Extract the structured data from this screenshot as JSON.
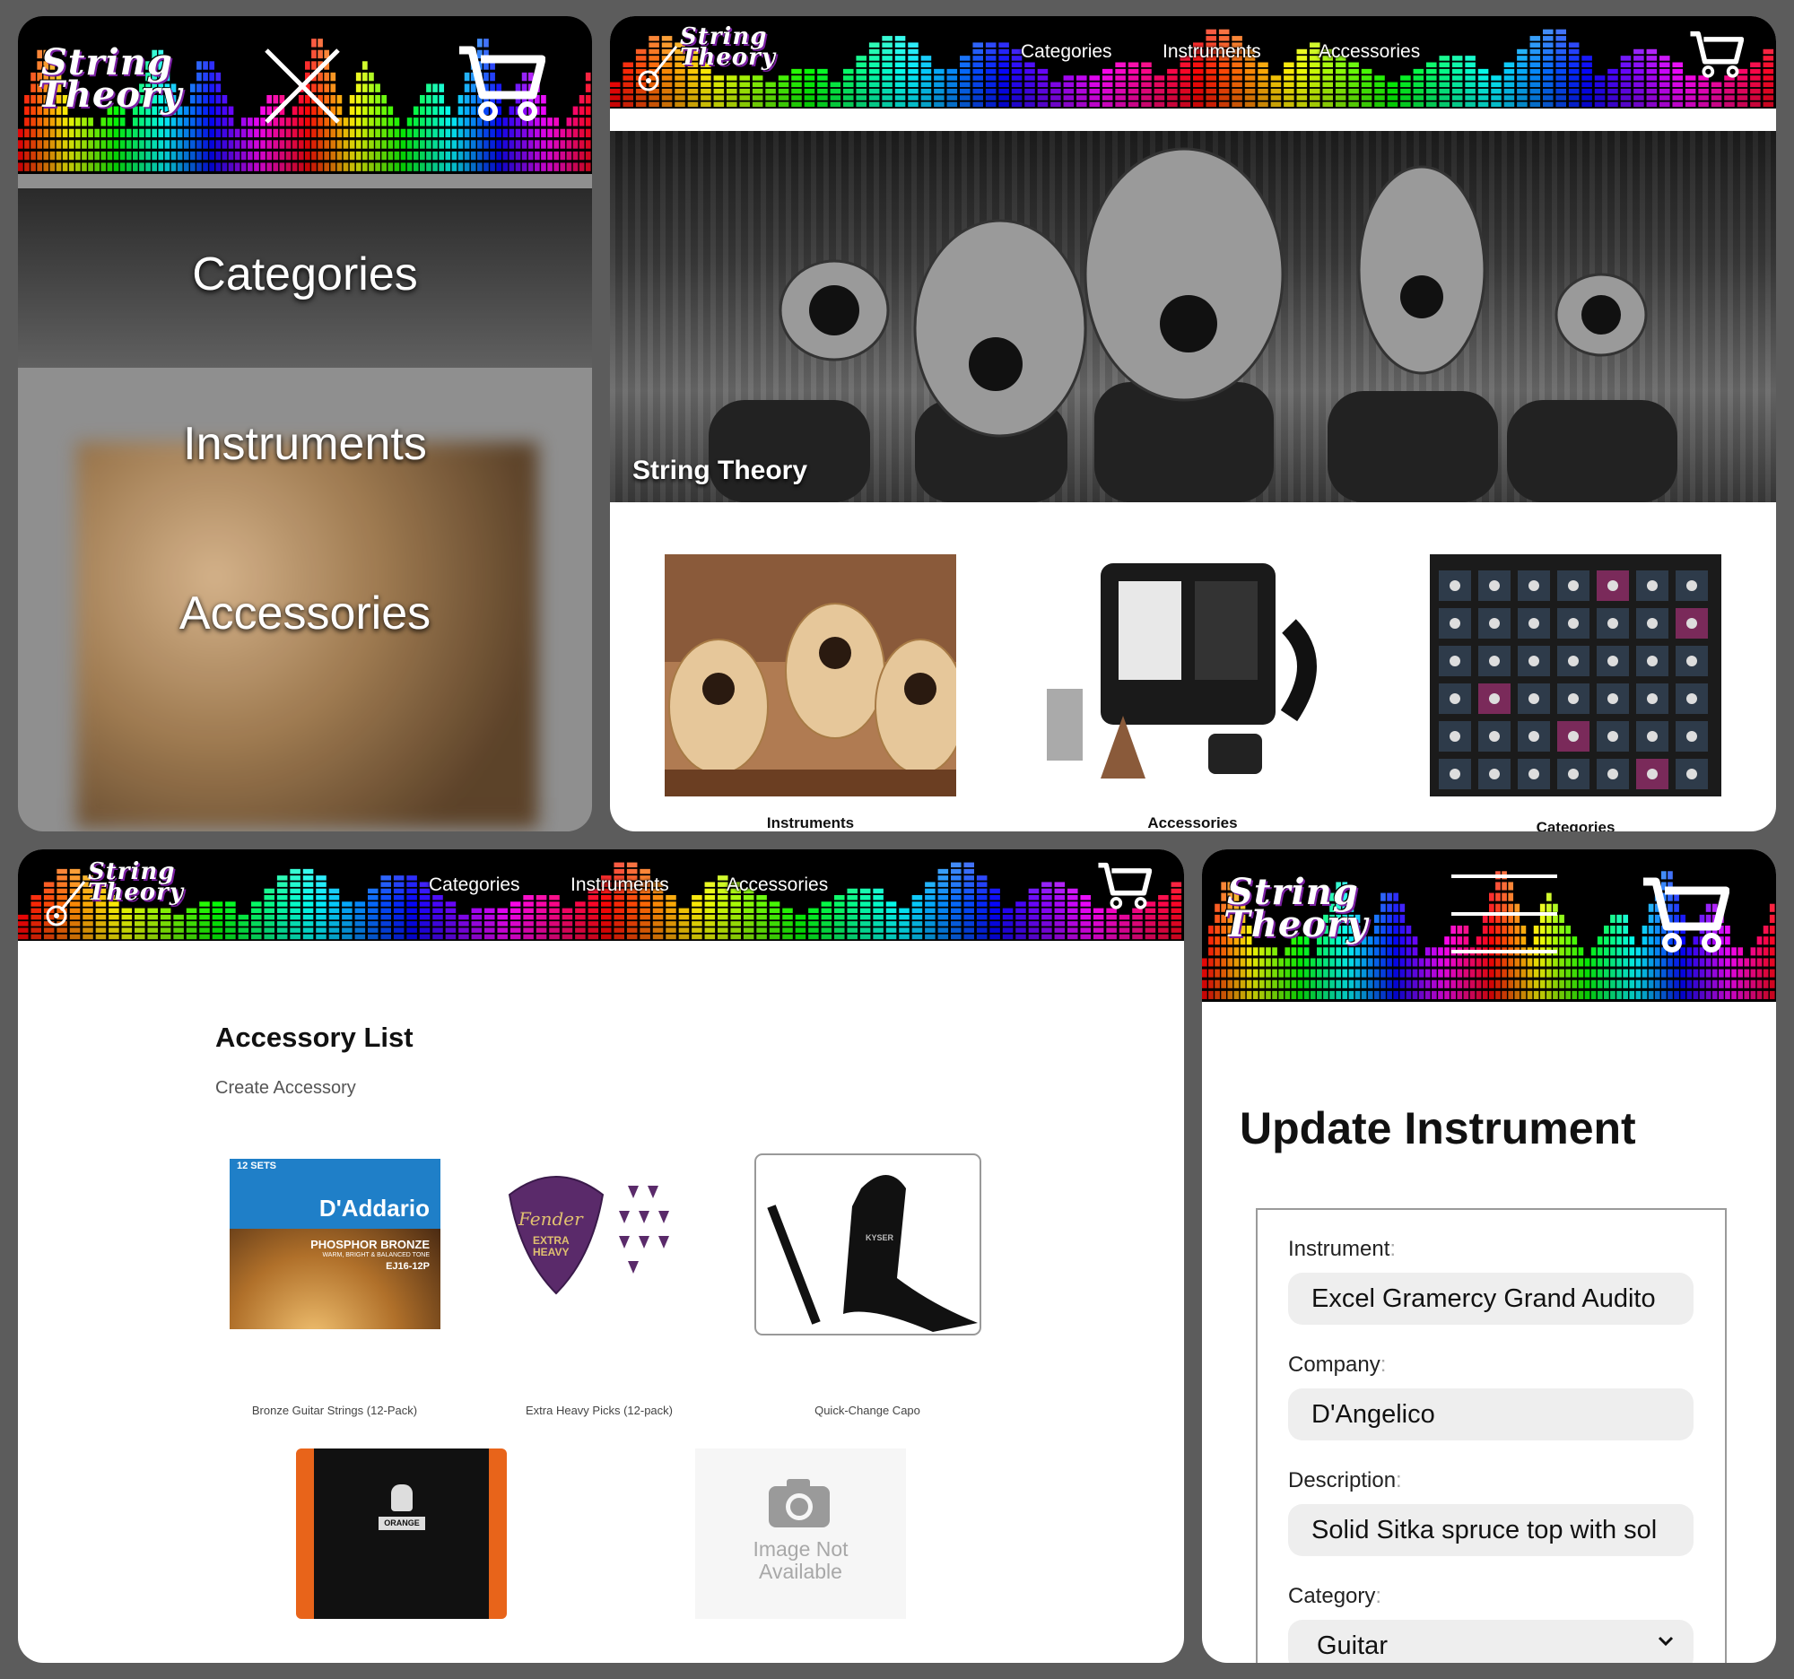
{
  "brand": {
    "line1": "String",
    "line2": "Theory"
  },
  "colors": {
    "page_bg": "#5c5c5c",
    "header_bg": "#000000",
    "accent_shadow": "#7a1fa2"
  },
  "mobile_menu": {
    "close_icon": "close-x-icon",
    "cart_icon": "shopping-cart-icon",
    "items": [
      "Categories",
      "Instruments",
      "Accessories"
    ]
  },
  "home": {
    "nav": [
      "Categories",
      "Instruments",
      "Accessories"
    ],
    "hero_title": "String Theory",
    "tiles": [
      {
        "caption": "Instruments"
      },
      {
        "caption": "Accessories"
      },
      {
        "caption": "Categories"
      }
    ]
  },
  "accessories": {
    "nav": [
      "Categories",
      "Instruments",
      "Accessories"
    ],
    "title": "Accessory List",
    "create_link": "Create Accessory",
    "items": [
      {
        "caption": "Bronze Guitar Strings (12-Pack)",
        "pack_label": "12 SETS",
        "brand": "D'Addario",
        "product": "PHOSPHOR BRONZE",
        "subtext": "WARM, BRIGHT & BALANCED TONE",
        "code": "EJ16-12P"
      },
      {
        "caption": "Extra Heavy Picks (12-pack)",
        "brand": "Fender",
        "product": "EXTRA HEAVY"
      },
      {
        "caption": "Quick-Change Capo",
        "brand": "KYSER"
      },
      {
        "caption": "",
        "brand": "ORANGE"
      },
      {
        "caption": "",
        "placeholder_line1": "Image Not",
        "placeholder_line2": "Available"
      }
    ]
  },
  "update_form": {
    "title": "Update Instrument",
    "fields": [
      {
        "label": "Instrument",
        "value": "Excel Gramercy Grand Audito"
      },
      {
        "label": "Company",
        "value": "D'Angelico"
      },
      {
        "label": "Description",
        "value": "Solid Sitka spruce top with sol"
      },
      {
        "label": "Category",
        "value": "Guitar"
      }
    ]
  }
}
